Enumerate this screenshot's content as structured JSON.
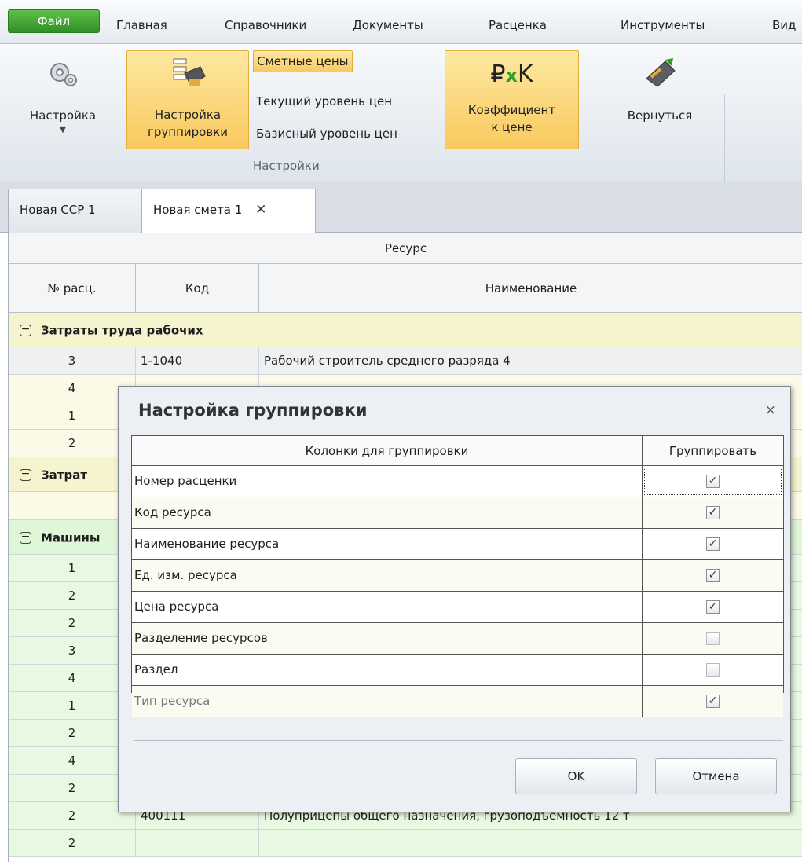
{
  "menu": {
    "file": "Файл",
    "items": [
      "Главная",
      "Справочники",
      "Документы",
      "Расценка",
      "Инструменты",
      "Вид"
    ]
  },
  "ribbon": {
    "settings": "Настройка",
    "grouping_line1": "Настройка",
    "grouping_line2": "группировки",
    "smetnye": "Сметные цены",
    "current_level": "Текущий уровень цен",
    "base_level": "Базисный уровень цен",
    "group_label": "Настройки",
    "coef_line1": "Коэффициент",
    "coef_line2": "к цене",
    "back": "Вернуться"
  },
  "tabs": [
    {
      "label": "Новая ССР 1"
    },
    {
      "label": "Новая смета 1"
    }
  ],
  "grid": {
    "header_group": "Ресурс",
    "columns": [
      "№ расц.",
      "Код",
      "Наименование"
    ],
    "groups": {
      "labor": "Затраты труда рабочих",
      "labor_partial": "Затрат",
      "machines_partial": "Машины"
    },
    "rows": [
      {
        "num": "3",
        "code": "1-1040",
        "name": "Рабочий строитель среднего разряда 4"
      },
      {
        "num": "4"
      },
      {
        "num": "1"
      },
      {
        "num": "2"
      },
      {
        "num": "1"
      },
      {
        "num": "2"
      },
      {
        "num": "2"
      },
      {
        "num": "3"
      },
      {
        "num": "4"
      },
      {
        "num": "1"
      },
      {
        "num": "2"
      },
      {
        "num": "4"
      },
      {
        "num": "2"
      },
      {
        "num": "2",
        "code": "400111",
        "name": "Полуприцепы общего назначения, грузоподъемность 12 т"
      },
      {
        "num": "2"
      }
    ]
  },
  "dialog": {
    "title": "Настройка группировки",
    "col_columns": "Колонки для группировки",
    "col_group": "Группировать",
    "rows": [
      {
        "name": "Номер расценки",
        "checked": true
      },
      {
        "name": "Код ресурса",
        "checked": true
      },
      {
        "name": "Наименование ресурса",
        "checked": true
      },
      {
        "name": "Ед. изм. ресурса",
        "checked": true
      },
      {
        "name": "Цена ресурса",
        "checked": true
      },
      {
        "name": "Разделение ресурсов",
        "checked": false
      },
      {
        "name": "Раздел",
        "checked": false
      },
      {
        "name": "Тип ресурса",
        "checked": true
      }
    ],
    "ok": "OK",
    "cancel": "Отмена"
  },
  "colors": {
    "accent_green": "#3fa12f",
    "ribbon_active": "#f9c95e",
    "row_yellow": "#fbfae6",
    "row_green": "#e7f9e1"
  }
}
